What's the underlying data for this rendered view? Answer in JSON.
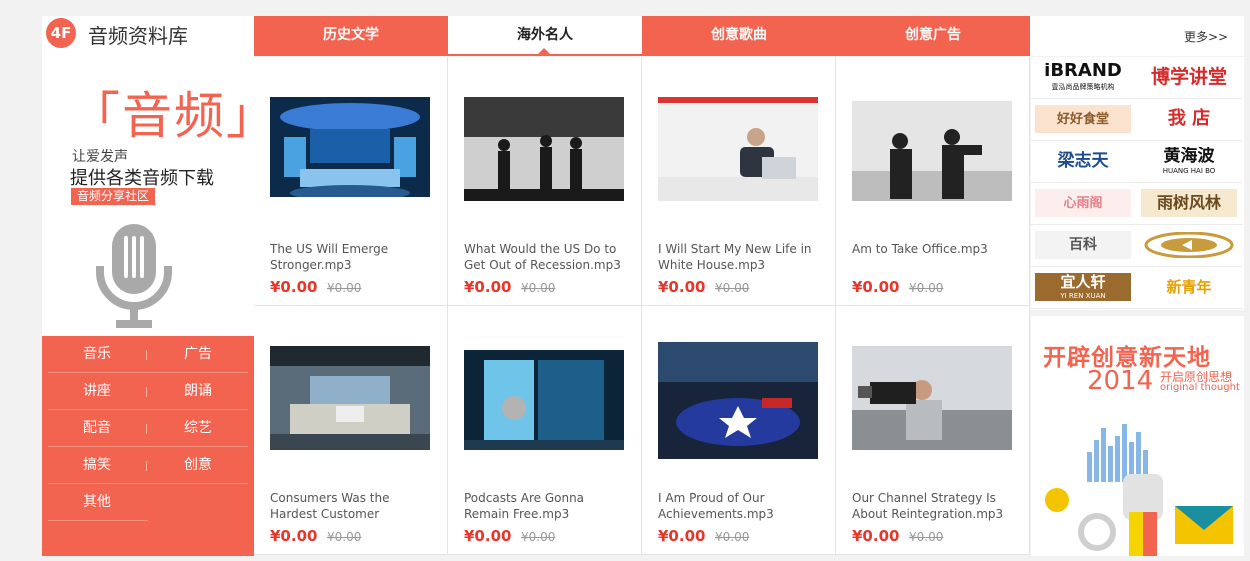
{
  "left": {
    "floor": "4F",
    "title": "音频资料库",
    "big_title": "「音频」",
    "sub1": "让爱发声",
    "sub2": "提供各类音频下载",
    "badge": "音频分享社区",
    "categories": [
      [
        "音乐",
        "广告"
      ],
      [
        "讲座",
        "朗诵"
      ],
      [
        "配音",
        "综艺"
      ],
      [
        "搞笑",
        "创意"
      ],
      [
        "其他",
        ""
      ]
    ]
  },
  "tabs": [
    "历史文学",
    "海外名人",
    "创意歌曲",
    "创意广告"
  ],
  "active_tab": 1,
  "more_link": "更多>>",
  "products": [
    {
      "name": "The US Will Emerge Stronger.mp3",
      "price": "¥0.00",
      "orig": "¥0.00",
      "icon": "news-studio-image"
    },
    {
      "name": "What Would the US Do to Get Out of Recession.mp3",
      "price": "¥0.00",
      "orig": "¥0.00",
      "icon": "film-crew-silhouette-image"
    },
    {
      "name": "I Will Start My New Life in White House.mp3",
      "price": "¥0.00",
      "orig": "¥0.00",
      "icon": "man-with-laptop-image"
    },
    {
      "name": "Am to Take Office.mp3",
      "price": "¥0.00",
      "orig": "¥0.00",
      "icon": "camera-operators-silhouette-image"
    },
    {
      "name": "Consumers Was the Hardest Customer",
      "price": "¥0.00",
      "orig": "¥0.00",
      "icon": "empty-studio-image"
    },
    {
      "name": "Podcasts Are Gonna Remain Free.mp3",
      "price": "¥0.00",
      "orig": "¥0.00",
      "icon": "studio-screens-image"
    },
    {
      "name": "I Am Proud of Our Achievements.mp3",
      "price": "¥0.00",
      "orig": "¥0.00",
      "icon": "star-stage-studio-image"
    },
    {
      "name": "Our Channel Strategy Is About Reintegration.mp3",
      "price": "¥0.00",
      "orig": "¥0.00",
      "icon": "video-camera-operator-image"
    }
  ],
  "brands": [
    {
      "text": "iBRAND",
      "sub": "壹泓尚品牌策略机构",
      "color": "#111111"
    },
    {
      "text": "博学讲堂",
      "sub": "",
      "color": "#d62b2b"
    },
    {
      "text": "好好食堂",
      "sub": "",
      "color": "#8a5a2a"
    },
    {
      "text": "我 店",
      "sub": "",
      "color": "#d62b2b"
    },
    {
      "text": "梁志天",
      "sub": "",
      "color": "#1b4d8f"
    },
    {
      "text": "黄海波",
      "sub": "HUANG HAI BO",
      "color": "#111111"
    },
    {
      "text": "心雨阁",
      "sub": "",
      "color": "#e6808a"
    },
    {
      "text": "雨树风林",
      "sub": "",
      "color": "#6b4a1e"
    },
    {
      "text": "百科",
      "sub": "",
      "color": "#555555"
    },
    {
      "text": "",
      "sub": "",
      "color": "#c89b3c"
    },
    {
      "text": "宜人轩",
      "sub": "YI REN XUAN",
      "color": "#ffffff"
    },
    {
      "text": "新青年",
      "sub": "",
      "color": "#e6a100"
    }
  ],
  "promo": {
    "title": "开辟创意新天地",
    "year": "2014",
    "line2": "开启原创思想",
    "line3": "original thought"
  },
  "colors": {
    "accent": "#f26350",
    "price": "#e8372a"
  }
}
